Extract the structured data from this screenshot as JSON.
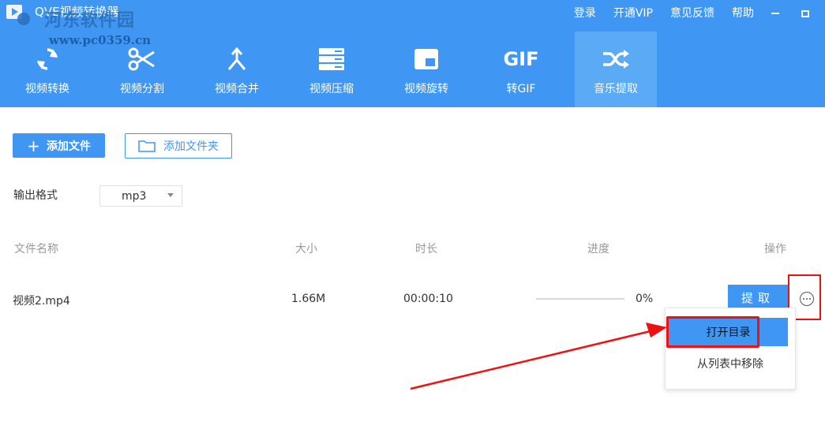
{
  "app": {
    "title": "QVE视频转换器",
    "watermark": "河东软件园",
    "watermark_url": "www.pc0359.cn"
  },
  "top_links": [
    "登录",
    "开通VIP",
    "意见反馈",
    "帮助"
  ],
  "tabs": [
    {
      "label": "视频转换",
      "icon": "refresh-icon"
    },
    {
      "label": "视频分割",
      "icon": "scissors-icon"
    },
    {
      "label": "视频合并",
      "icon": "merge-icon"
    },
    {
      "label": "视频压缩",
      "icon": "compress-icon"
    },
    {
      "label": "视频旋转",
      "icon": "rotate-icon"
    },
    {
      "label": "转GIF",
      "icon": "gif-icon"
    },
    {
      "label": "音乐提取",
      "icon": "shuffle-icon",
      "active": true
    }
  ],
  "toolbar": {
    "add_file": "添加文件",
    "add_folder": "添加文件夹"
  },
  "output_format": {
    "label": "输出格式",
    "value": "mp3"
  },
  "table": {
    "headers": {
      "name": "文件名称",
      "size": "大小",
      "duration": "时长",
      "progress": "进度",
      "action": "操作"
    },
    "rows": [
      {
        "name": "视频2.mp4",
        "size": "1.66M",
        "duration": "00:00:10",
        "progress_text": "0%",
        "progress": 0,
        "action": "提取"
      }
    ]
  },
  "menu": {
    "open_dir": "打开目录",
    "remove": "从列表中移除"
  },
  "colors": {
    "brand": "#3f96f3",
    "annotation": "#f01010"
  }
}
